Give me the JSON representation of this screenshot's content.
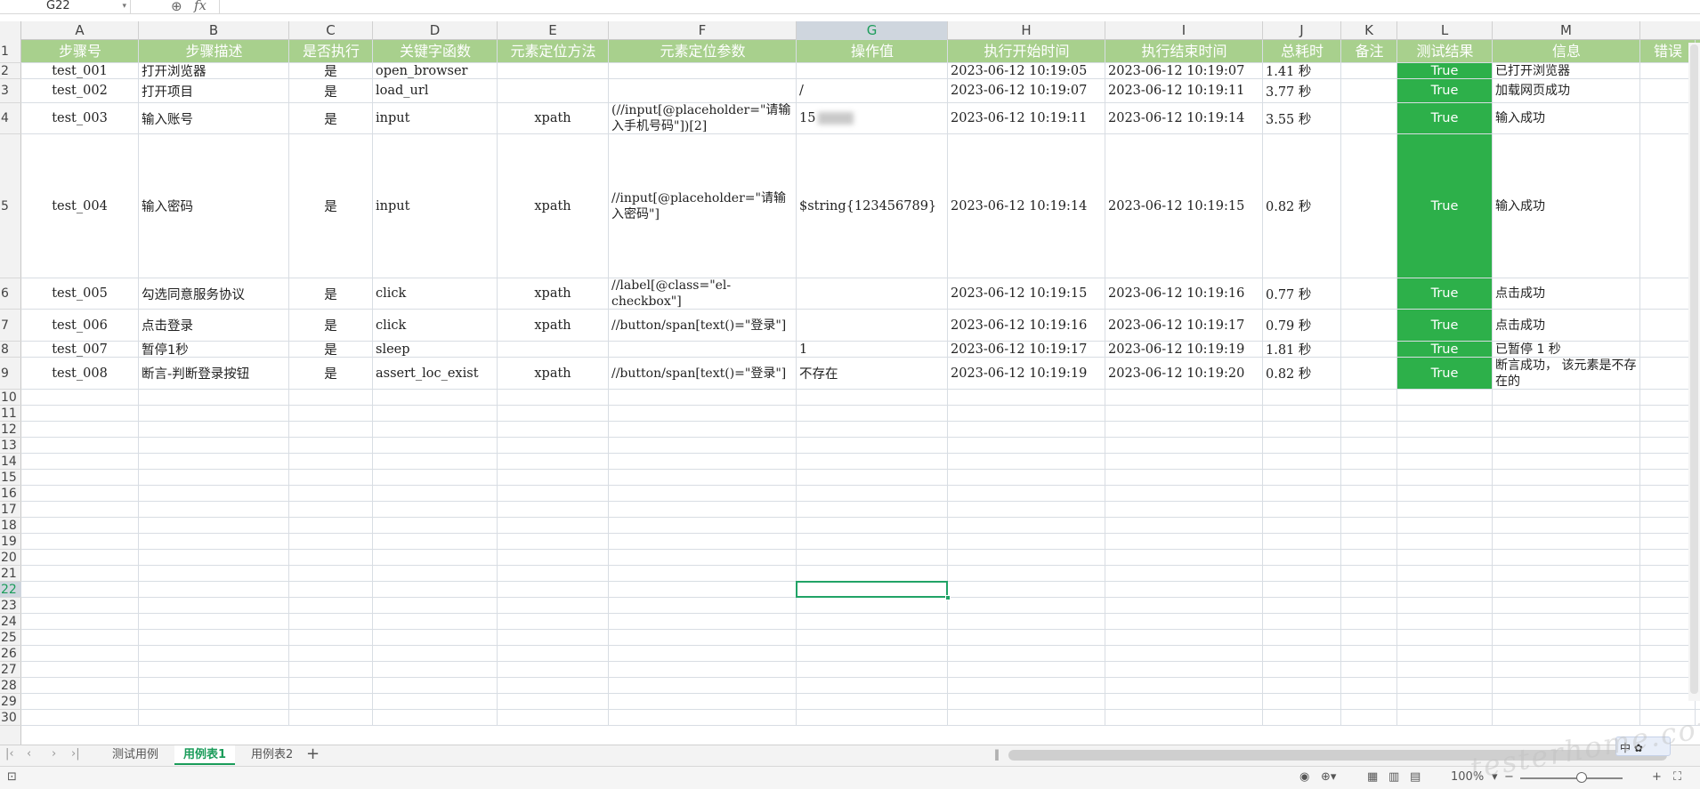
{
  "formula_bar": {
    "name_box": "G22",
    "fx": "fx"
  },
  "columns": [
    "A",
    "B",
    "C",
    "D",
    "E",
    "F",
    "G",
    "H",
    "I",
    "J",
    "K",
    "L",
    "M"
  ],
  "active_column": "G",
  "rows": [
    "1",
    "2",
    "3",
    "4",
    "5",
    "6",
    "7",
    "8",
    "9",
    "10",
    "11",
    "12",
    "13",
    "14",
    "15",
    "16",
    "17",
    "18",
    "19",
    "20",
    "21",
    "22",
    "23",
    "24",
    "25",
    "26",
    "27",
    "28",
    "29",
    "30"
  ],
  "active_row": "22",
  "headers": [
    "步骤号",
    "步骤描述",
    "是否执行",
    "关键字函数",
    "元素定位方法",
    "元素定位参数",
    "操作值",
    "执行开始时间",
    "执行结束时间",
    "总耗时",
    "备注",
    "测试结果",
    "信息",
    "错误"
  ],
  "data_rows": [
    {
      "A": "test_001",
      "B": "打开浏览器",
      "C": "是",
      "D": "open_browser",
      "E": "",
      "F": "",
      "G": "",
      "H": "2023-06-12 10:19:05",
      "I": "2023-06-12 10:19:07",
      "J": "1.41 秒",
      "K": "",
      "L": "True",
      "M": "已打开浏览器"
    },
    {
      "A": "test_002",
      "B": "打开项目",
      "C": "是",
      "D": "load_url",
      "E": "",
      "F": "",
      "G": "/",
      "H": "2023-06-12 10:19:07",
      "I": "2023-06-12 10:19:11",
      "J": "3.77 秒",
      "K": "",
      "L": "True",
      "M": "加载网页成功"
    },
    {
      "A": "test_003",
      "B": "输入账号",
      "C": "是",
      "D": "input",
      "E": "xpath",
      "F": "(//input[@placeholder=\"请输入手机号码\"])[2]",
      "G": "15",
      "H": "2023-06-12 10:19:11",
      "I": "2023-06-12 10:19:14",
      "J": "3.55 秒",
      "K": "",
      "L": "True",
      "M": "输入成功"
    },
    {
      "A": "test_004",
      "B": "输入密码",
      "C": "是",
      "D": "input",
      "E": "xpath",
      "F": "//input[@placeholder=\"请输入密码\"]",
      "G": "$string{123456789}",
      "H": "2023-06-12 10:19:14",
      "I": "2023-06-12 10:19:15",
      "J": "0.82 秒",
      "K": "",
      "L": "True",
      "M": "输入成功"
    },
    {
      "A": "test_005",
      "B": "勾选同意服务协议",
      "C": "是",
      "D": "click",
      "E": "xpath",
      "F": "//label[@class=\"el-checkbox\"]",
      "G": "",
      "H": "2023-06-12 10:19:15",
      "I": "2023-06-12 10:19:16",
      "J": "0.77 秒",
      "K": "",
      "L": "True",
      "M": "点击成功"
    },
    {
      "A": "test_006",
      "B": "点击登录",
      "C": "是",
      "D": "click",
      "E": "xpath",
      "F": "//button/span[text()=\"登录\"]",
      "G": "",
      "H": "2023-06-12 10:19:16",
      "I": "2023-06-12 10:19:17",
      "J": "0.79 秒",
      "K": "",
      "L": "True",
      "M": "点击成功"
    },
    {
      "A": "test_007",
      "B": "暂停1秒",
      "C": "是",
      "D": "sleep",
      "E": "",
      "F": "",
      "G": "1",
      "H": "2023-06-12 10:19:17",
      "I": "2023-06-12 10:19:19",
      "J": "1.81 秒",
      "K": "",
      "L": "True",
      "M": "已暂停 1 秒"
    },
    {
      "A": "test_008",
      "B": "断言-判断登录按钮",
      "C": "是",
      "D": "assert_loc_exist",
      "E": "xpath",
      "F": "//button/span[text()=\"登录\"]",
      "G": "不存在",
      "H": "2023-06-12 10:19:19",
      "I": "2023-06-12 10:19:20",
      "J": "0.82 秒",
      "K": "",
      "L": "True",
      "M": "断言成功， 该元素是不存在的"
    }
  ],
  "sheet_tabs": [
    "测试用例",
    "用例表1",
    "用例表2"
  ],
  "active_sheet": "用例表1",
  "status": {
    "zoom": "100%",
    "ime": "中"
  },
  "colors": {
    "header_green": "#a8d08d",
    "true_green": "#2db04a",
    "accent": "#21a366"
  },
  "watermark": "testerhome.com"
}
